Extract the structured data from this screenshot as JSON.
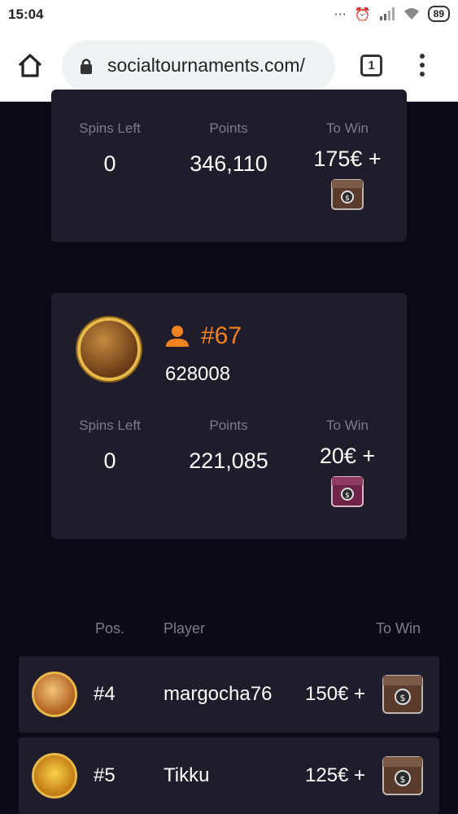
{
  "status_bar": {
    "time": "15:04",
    "battery": "89"
  },
  "browser": {
    "url": "socialtournaments.com/",
    "tab_count": "1"
  },
  "card_top": {
    "labels": {
      "spins": "Spins Left",
      "points": "Points",
      "to_win": "To Win"
    },
    "spins_left": "0",
    "points": "346,110",
    "to_win": "175€ +"
  },
  "card_player": {
    "rank": "#67",
    "player_id": "628008",
    "labels": {
      "spins": "Spins Left",
      "points": "Points",
      "to_win": "To Win"
    },
    "spins_left": "0",
    "points": "221,085",
    "to_win": "20€ +"
  },
  "leaderboard": {
    "headers": {
      "pos": "Pos.",
      "player": "Player",
      "to_win": "To Win"
    },
    "rows": [
      {
        "pos": "#4",
        "player": "margocha76",
        "prize": "150€ +"
      },
      {
        "pos": "#5",
        "player": "Tikku",
        "prize": "125€ +"
      }
    ]
  },
  "colors": {
    "accent": "#f0821f",
    "card_bg": "#1f1c2c",
    "page_bg": "#0c0a17",
    "muted": "#7d7b88"
  }
}
